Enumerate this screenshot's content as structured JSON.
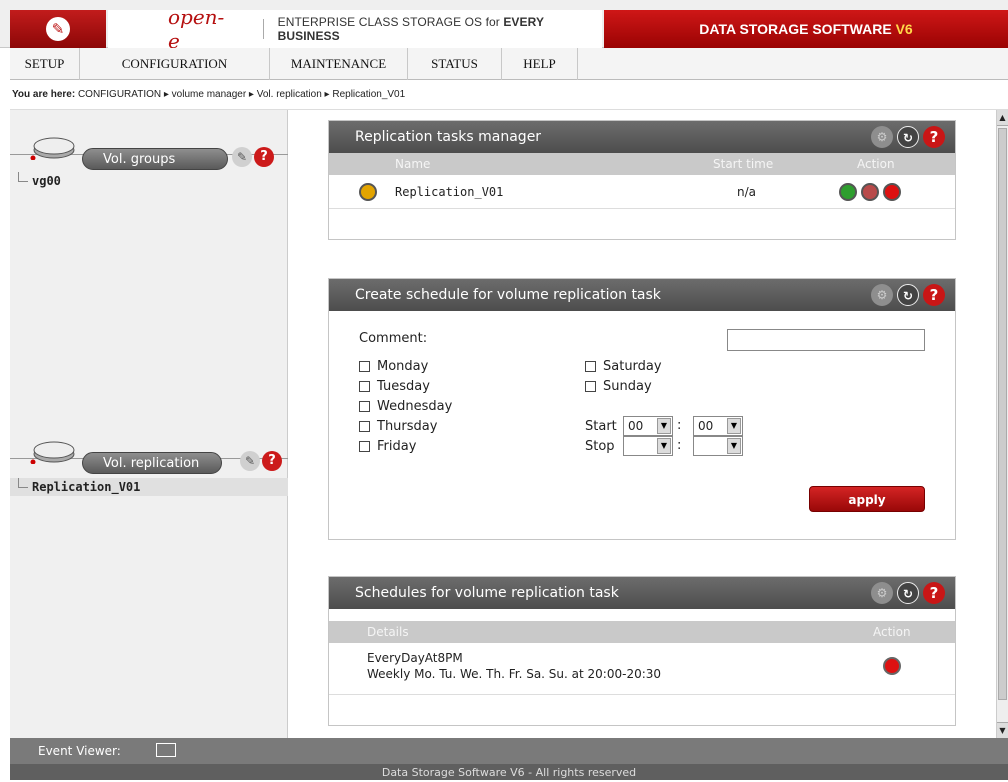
{
  "header": {
    "brand": "open-e",
    "tagline_prefix": "ENTERPRISE CLASS STORAGE OS for ",
    "tagline_bold": "EVERY BUSINESS",
    "product": "DATA STORAGE SOFTWARE ",
    "product_version": "V6"
  },
  "menu": [
    {
      "label": "SETUP"
    },
    {
      "label": "CONFIGURATION"
    },
    {
      "label": "MAINTENANCE"
    },
    {
      "label": "STATUS"
    },
    {
      "label": "HELP"
    }
  ],
  "breadcrumb": {
    "prefix": "You are here:",
    "path": "CONFIGURATION ▸ volume manager ▸ Vol. replication ▸ Replication_V01"
  },
  "left": {
    "vol_groups_title": "Vol. groups",
    "vol_groups_items": [
      "vg00"
    ],
    "vol_replication_title": "Vol. replication",
    "vol_replication_items": [
      "Replication_V01"
    ]
  },
  "tasks_panel": {
    "title": "Replication tasks manager",
    "col_name": "Name",
    "col_start": "Start time",
    "col_action": "Action",
    "rows": [
      {
        "name": "Replication_V01",
        "start": "n/a"
      }
    ]
  },
  "schedule_panel": {
    "title": "Create schedule for volume replication task",
    "comment_label": "Comment:",
    "comment_value": "",
    "days_left": [
      "Monday",
      "Tuesday",
      "Wednesday",
      "Thursday",
      "Friday"
    ],
    "days_right": [
      "Saturday",
      "Sunday"
    ],
    "start_label": "Start",
    "stop_label": "Stop",
    "start_hour": "00",
    "start_min": "00",
    "stop_hour": "",
    "stop_min": "",
    "apply_label": "apply"
  },
  "schedules_panel": {
    "title": "Schedules for volume replication task",
    "col_details": "Details",
    "col_action": "Action",
    "entry_name": "EveryDayAt8PM",
    "entry_desc": "Weekly Mo. Tu. We. Th. Fr. Sa. Su. at 20:00-20:30"
  },
  "event_viewer": "Event Viewer:",
  "footer": "Data Storage Software V6 - All rights reserved",
  "colors": {
    "brand_red": "#b50f0f",
    "panel_header": "#5a5a5a"
  }
}
